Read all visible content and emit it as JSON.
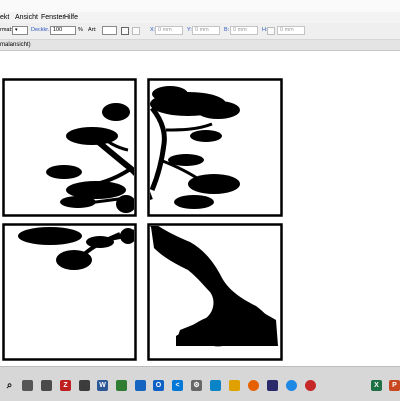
{
  "menu": [
    "ekt",
    "Ansicht",
    "Fenster",
    "Hilfe"
  ],
  "toolbar": {
    "label_format": "rmat:",
    "label_opacity": "Deckkr.:",
    "opacity_value": "100",
    "opacity_unit": "%",
    "label_art": "Art:",
    "label_x": "X:",
    "label_y": "Y:",
    "label_w": "B:",
    "label_h": "H:",
    "x_value": "0 mm",
    "y_value": "0 mm",
    "w_value": "0 mm",
    "h_value": "0 mm"
  },
  "document_tab": "malansicht)",
  "taskbar": {
    "icons": [
      "search-icon",
      "task-view-icon",
      "file-explorer-icon",
      "filezilla-icon",
      "calculator-icon",
      "word-icon",
      "browser-icon",
      "mail-icon",
      "outlook-icon",
      "vscode-icon",
      "settings-icon",
      "photos-icon",
      "folder-icon",
      "firefox-icon",
      "app-icon",
      "edge-icon",
      "opera-icon",
      "excel-icon",
      "powerpoint-icon"
    ],
    "colors": {
      "filezilla": "#bf1f1f",
      "word": "#2b5797",
      "excel": "#1e7145",
      "vscode": "#0078d7",
      "firefox": "#e66000",
      "outlook": "#0f62c5"
    }
  }
}
